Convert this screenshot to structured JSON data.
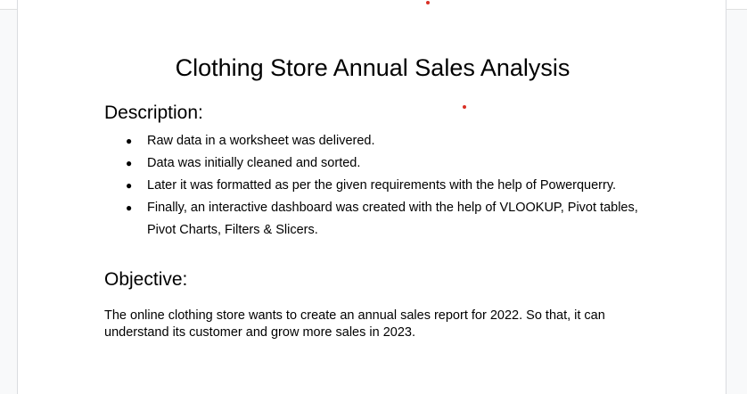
{
  "document": {
    "title": "Clothing Store Annual Sales Analysis",
    "description_heading": "Description:",
    "bullets": [
      "Raw data in a worksheet was delivered.",
      "Data was initially cleaned and sorted.",
      "Later it was formatted as per the given requirements with the help of Powerquerry.",
      "Finally, an interactive dashboard was created with the help of VLOOKUP, Pivot tables, Pivot Charts, Filters & Slicers."
    ],
    "objective_heading": "Objective:",
    "objective_text": "The online clothing store wants to create an annual sales report for 2022. So that, it can understand its customer and grow more sales in 2023."
  },
  "colors": {
    "page": "#ffffff",
    "background": "#f8f9fa",
    "text": "#000000",
    "cursor_marker": "#d93025"
  }
}
